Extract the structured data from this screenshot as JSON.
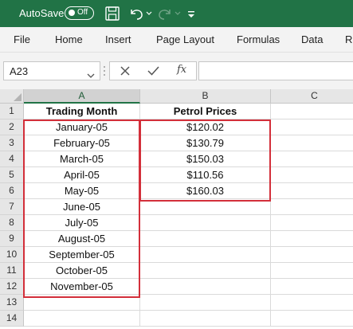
{
  "titlebar": {
    "autosave_label": "AutoSave",
    "autosave_state": "Off",
    "icons": [
      "save-icon",
      "undo-icon",
      "undo-dropdown-icon",
      "redo-icon",
      "redo-dropdown-icon",
      "customize-toolbar-icon"
    ]
  },
  "ribbon": {
    "tabs": [
      "File",
      "Home",
      "Insert",
      "Page Layout",
      "Formulas",
      "Data",
      "R"
    ]
  },
  "formula_bar": {
    "name_box": "A23",
    "fx": "fx",
    "formula": ""
  },
  "sheet": {
    "columns": [
      "A",
      "B",
      "C"
    ],
    "rows": [
      "1",
      "2",
      "3",
      "4",
      "5",
      "6",
      "7",
      "8",
      "9",
      "10",
      "11",
      "12",
      "13",
      "14"
    ],
    "cells": [
      [
        "Trading Month",
        "Petrol Prices",
        ""
      ],
      [
        "January-05",
        "$120.02",
        ""
      ],
      [
        "February-05",
        "$130.79",
        ""
      ],
      [
        "March-05",
        "$150.03",
        ""
      ],
      [
        "April-05",
        "$110.56",
        ""
      ],
      [
        "May-05",
        "$160.03",
        ""
      ],
      [
        "June-05",
        "",
        ""
      ],
      [
        "July-05",
        "",
        ""
      ],
      [
        "August-05",
        "",
        ""
      ],
      [
        "September-05",
        "",
        ""
      ],
      [
        "October-05",
        "",
        ""
      ],
      [
        "November-05",
        "",
        ""
      ],
      [
        "",
        "",
        ""
      ],
      [
        "",
        "",
        ""
      ]
    ]
  },
  "colors": {
    "excel_green": "#217346",
    "highlight_red": "#d32f3a"
  }
}
